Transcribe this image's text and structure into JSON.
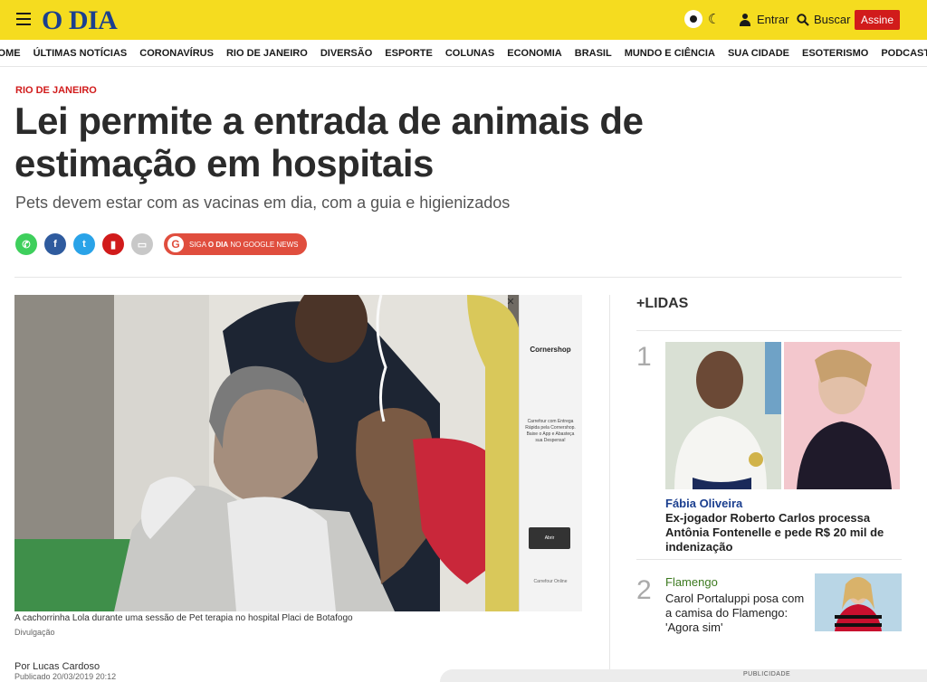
{
  "header": {
    "logo": "O DIA",
    "login_label": "Entrar",
    "search_label": "Buscar",
    "subscribe_label": "Assine",
    "icons": [
      "menu-icon",
      "sun-icon",
      "moon-icon",
      "user-icon",
      "search-icon"
    ],
    "brand_yellow": "#f5dc1f",
    "brand_blue": "#1b3f8f",
    "accent_red": "#d11b1b"
  },
  "nav": {
    "items": [
      "HOME",
      "ÚLTIMAS NOTÍCIAS",
      "CORONAVÍRUS",
      "RIO DE JANEIRO",
      "DIVERSÃO",
      "ESPORTE",
      "COLUNAS",
      "ECONOMIA",
      "BRASIL",
      "MUNDO E CIÊNCIA",
      "SUA CIDADE",
      "ESOTERISMO",
      "PODCASTS"
    ]
  },
  "article": {
    "section": "RIO DE JANEIRO",
    "headline": "Lei permite a entrada de animais de estimação em hospitais",
    "subheadline": "Pets devem estar com as vacinas em dia, com a guia e higienizados",
    "google_news": {
      "prefix": "SIGA ",
      "brand": "O DIA",
      "suffix": " NO GOOGLE NEWS"
    },
    "caption": "A cachorrinha Lola durante uma sessão de Pet terapia no hospital Placi de Botafogo",
    "credit": "Divulgação",
    "author": "Por Lucas Cardoso",
    "published": "Publicado 20/03/2019 20:12"
  },
  "ad": {
    "close": "✕",
    "brand": "Cornershop",
    "text": "Carrefour com Entrega Rápida pela Cornershop. Baixe o App e Abasteça sua Despensa!",
    "button": "Abrir",
    "footer": "Carrefour Online"
  },
  "sidebar": {
    "title": "+LIDAS",
    "items": [
      {
        "rank": "1",
        "category": "Fábia Oliveira",
        "title": "Ex-jogador Roberto Carlos processa Antônia Fontenelle e pede R$ 20 mil de indenização"
      },
      {
        "rank": "2",
        "category": "Flamengo",
        "title": "Carol Portaluppi posa com a camisa do Flamengo: 'Agora sim'"
      }
    ]
  },
  "publicidade": "PUBLICIDADE"
}
